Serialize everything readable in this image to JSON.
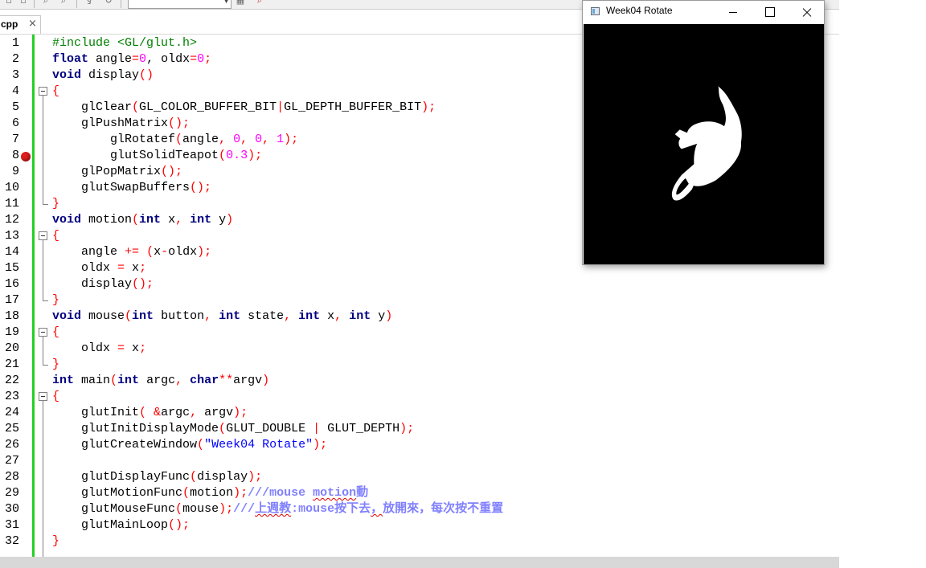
{
  "editor": {
    "tab": {
      "label": "cpp",
      "close": "×"
    },
    "line_numbers": [
      "1",
      "2",
      "3",
      "4",
      "5",
      "6",
      "7",
      "8",
      "9",
      "10",
      "11",
      "12",
      "13",
      "14",
      "15",
      "16",
      "17",
      "18",
      "19",
      "20",
      "21",
      "22",
      "23",
      "24",
      "25",
      "26",
      "27",
      "28",
      "29",
      "30",
      "31",
      "32"
    ],
    "code": {
      "l1_include": "#include <GL/glut.h>",
      "l2_kw": "float",
      "l2_mid": " angle",
      "l2_eq1": "=",
      "l2_zero1": "0",
      "l2_comma": ", oldx",
      "l2_eq2": "=",
      "l2_zero2": "0",
      "l2_semi": ";",
      "l3_kw": "void",
      "l3_name": " display",
      "l3_par": "()",
      "brace_open": "{",
      "brace_close": "}",
      "l5_fn": "glClear",
      "l5_p1": "(",
      "l5_a": "GL_COLOR_BUFFER_BIT",
      "l5_pipe": "|",
      "l5_b": "GL_DEPTH_BUFFER_BIT",
      "l5_p2": ");",
      "l6_fn": "glPushMatrix",
      "l6_p": "();",
      "l7_fn": "glRotatef",
      "l7_p1": "(",
      "l7_a": "angle",
      "l7_c1": ", ",
      "l7_n1": "0",
      "l7_c2": ", ",
      "l7_n2": "0",
      "l7_c3": ", ",
      "l7_n3": "1",
      "l7_p2": ");",
      "l8_fn": "glutSolidTeapot",
      "l8_p1": "(",
      "l8_n": "0.3",
      "l8_p2": ");",
      "l9_fn": "glPopMatrix",
      "l9_p": "();",
      "l10_fn": "glutSwapBuffers",
      "l10_p": "();",
      "l12_kw": "void",
      "l12_name": " motion",
      "l12_p1": "(",
      "l12_t1": "int",
      "l12_x": " x",
      "l12_c": ", ",
      "l12_t2": "int",
      "l12_y": " y",
      "l12_p2": ")",
      "l14_a": "angle ",
      "l14_op": "+=",
      "l14_sp": " ",
      "l14_p1": "(",
      "l14_b": "x",
      "l14_minus": "-",
      "l14_c": "oldx",
      "l14_p2": ");",
      "l15_a": "oldx ",
      "l15_op": "=",
      "l15_b": " x",
      "l15_s": ";",
      "l16_fn": "display",
      "l16_p": "();",
      "l18_kw": "void",
      "l18_name": " mouse",
      "l18_p1": "(",
      "l18_t1": "int",
      "l18_v1": " button",
      "l18_c1": ", ",
      "l18_t2": "int",
      "l18_v2": " state",
      "l18_c2": ", ",
      "l18_t3": "int",
      "l18_v3": " x",
      "l18_c3": ", ",
      "l18_t4": "int",
      "l18_v4": " y",
      "l18_p2": ")",
      "l20_a": "oldx ",
      "l20_op": "=",
      "l20_b": " x",
      "l20_s": ";",
      "l22_kw": "int",
      "l22_name": " main",
      "l22_p1": "(",
      "l22_t1": "int",
      "l22_v1": " argc",
      "l22_c": ", ",
      "l22_t2": "char",
      "l22_st": "**",
      "l22_v2": "argv",
      "l22_p2": ")",
      "l24_fn": "glutInit",
      "l24_p1": "( ",
      "l24_amp": "&",
      "l24_a": "argc",
      "l24_c": ", ",
      "l24_b": "argv",
      "l24_p2": ");",
      "l25_fn": "glutInitDisplayMode",
      "l25_p1": "(",
      "l25_a": "GLUT_DOUBLE ",
      "l25_pipe": "|",
      "l25_b": " GLUT_DEPTH",
      "l25_p2": ");",
      "l26_fn": "glutCreateWindow",
      "l26_p1": "(",
      "l26_str": "\"Week04 Rotate\"",
      "l26_p2": ");",
      "l28_fn": "glutDisplayFunc",
      "l28_p1": "(",
      "l28_a": "display",
      "l28_p2": ");",
      "l29_fn": "glutMotionFunc",
      "l29_p1": "(",
      "l29_a": "motion",
      "l29_p2": ");",
      "l29_cm1": "///mouse ",
      "l29_cm2": "motion",
      "l29_cm3": "動",
      "l30_fn": "glutMouseFunc",
      "l30_p1": "(",
      "l30_a": "mouse",
      "l30_p2": ");",
      "l30_cm1": "///",
      "l30_cm2": "上週教",
      "l30_cm3": ":mouse",
      "l30_cm4": "按下去",
      "l30_cm5": "，",
      "l30_cm6": "放開來，每次按不重置",
      "l31_fn": "glutMainLoop",
      "l31_p": "();"
    }
  },
  "gl_window": {
    "title": "Week04 Rotate",
    "background": "#000000",
    "teapot_color": "#ffffff",
    "rotation_degrees": -30
  },
  "colors": {
    "keyword": "#000080",
    "preprocessor": "#008000",
    "number": "#ff00ff",
    "operator": "#ff0000",
    "string": "#0000ff",
    "comment": "#8080ff",
    "change_bar": "#24cf24",
    "breakpoint": "#e11d1d"
  }
}
